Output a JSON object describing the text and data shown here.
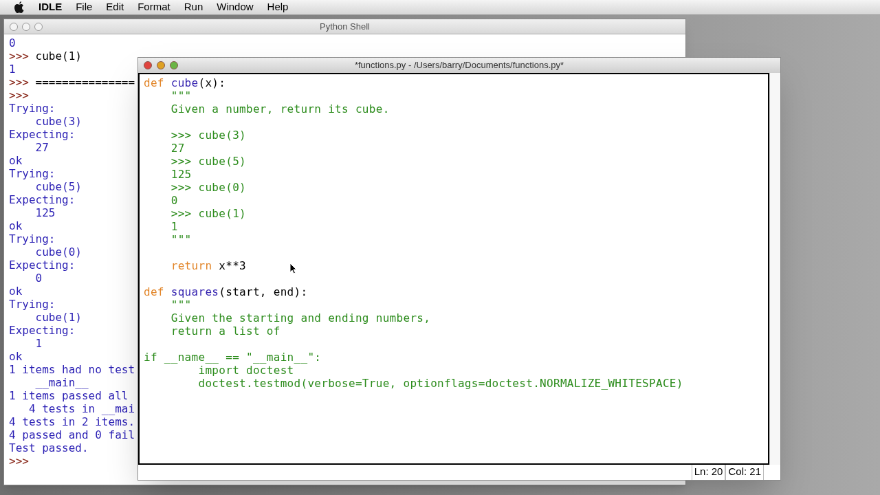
{
  "menu_bar": {
    "app": "IDLE",
    "items": [
      "File",
      "Edit",
      "Format",
      "Run",
      "Window",
      "Help"
    ]
  },
  "shell_window": {
    "title": "Python Shell",
    "active": false,
    "lines": [
      [
        {
          "text": "0",
          "kind": "output"
        }
      ],
      [
        {
          "text": ">>> ",
          "kind": "prompt"
        },
        {
          "text": "cube(1)",
          "kind": "input"
        }
      ],
      [
        {
          "text": "1",
          "kind": "output"
        }
      ],
      [
        {
          "text": ">>> ",
          "kind": "prompt"
        },
        {
          "text": "===============",
          "kind": "input"
        }
      ],
      [
        {
          "text": ">>>",
          "kind": "prompt"
        }
      ],
      [
        {
          "text": "Trying:",
          "kind": "output"
        }
      ],
      [
        {
          "text": "    cube(3)",
          "kind": "output"
        }
      ],
      [
        {
          "text": "Expecting:",
          "kind": "output"
        }
      ],
      [
        {
          "text": "    27",
          "kind": "output"
        }
      ],
      [
        {
          "text": "ok",
          "kind": "output"
        }
      ],
      [
        {
          "text": "Trying:",
          "kind": "output"
        }
      ],
      [
        {
          "text": "    cube(5)",
          "kind": "output"
        }
      ],
      [
        {
          "text": "Expecting:",
          "kind": "output"
        }
      ],
      [
        {
          "text": "    125",
          "kind": "output"
        }
      ],
      [
        {
          "text": "ok",
          "kind": "output"
        }
      ],
      [
        {
          "text": "Trying:",
          "kind": "output"
        }
      ],
      [
        {
          "text": "    cube(0)",
          "kind": "output"
        }
      ],
      [
        {
          "text": "Expecting:",
          "kind": "output"
        }
      ],
      [
        {
          "text": "    0",
          "kind": "output"
        }
      ],
      [
        {
          "text": "ok",
          "kind": "output"
        }
      ],
      [
        {
          "text": "Trying:",
          "kind": "output"
        }
      ],
      [
        {
          "text": "    cube(1)",
          "kind": "output"
        }
      ],
      [
        {
          "text": "Expecting:",
          "kind": "output"
        }
      ],
      [
        {
          "text": "    1",
          "kind": "output"
        }
      ],
      [
        {
          "text": "ok",
          "kind": "output"
        }
      ],
      [
        {
          "text": "1 items had no test",
          "kind": "output"
        }
      ],
      [
        {
          "text": "    __main__",
          "kind": "output"
        }
      ],
      [
        {
          "text": "1 items passed all",
          "kind": "output"
        }
      ],
      [
        {
          "text": "   4 tests in __mai",
          "kind": "output"
        }
      ],
      [
        {
          "text": "4 tests in 2 items.",
          "kind": "output"
        }
      ],
      [
        {
          "text": "4 passed and 0 fail",
          "kind": "output"
        }
      ],
      [
        {
          "text": "Test passed.",
          "kind": "output"
        }
      ],
      [
        {
          "text": ">>>",
          "kind": "prompt"
        }
      ]
    ]
  },
  "editor_window": {
    "title": "*functions.py - /Users/barry/Documents/functions.py*",
    "active": true,
    "lines": [
      {
        "segments": [
          {
            "text": "def ",
            "kind": "keyword"
          },
          {
            "text": "cube",
            "kind": "definition"
          },
          {
            "text": "(x):",
            "kind": "plain"
          }
        ],
        "blank_after": false
      },
      {
        "segments": [
          {
            "text": "    \"\"\"",
            "kind": "string"
          }
        ],
        "blank_after": false
      },
      {
        "segments": [
          {
            "text": "    Given a number, return its cube.",
            "kind": "string"
          }
        ],
        "blank_after": true
      },
      {
        "segments": [
          {
            "text": "    >>> cube(3)",
            "kind": "string"
          }
        ],
        "blank_after": false
      },
      {
        "segments": [
          {
            "text": "    27",
            "kind": "string"
          }
        ],
        "blank_after": false
      },
      {
        "segments": [
          {
            "text": "    >>> cube(5)",
            "kind": "string"
          }
        ],
        "blank_after": false
      },
      {
        "segments": [
          {
            "text": "    125",
            "kind": "string"
          }
        ],
        "blank_after": false
      },
      {
        "segments": [
          {
            "text": "    >>> cube(0)",
            "kind": "string"
          }
        ],
        "blank_after": false
      },
      {
        "segments": [
          {
            "text": "    0",
            "kind": "string"
          }
        ],
        "blank_after": false
      },
      {
        "segments": [
          {
            "text": "    >>> cube(1)",
            "kind": "string"
          }
        ],
        "blank_after": false
      },
      {
        "segments": [
          {
            "text": "    1",
            "kind": "string"
          }
        ],
        "blank_after": false
      },
      {
        "segments": [
          {
            "text": "    \"\"\"",
            "kind": "string"
          }
        ],
        "blank_after": true
      },
      {
        "segments": [
          {
            "text": "    return",
            "kind": "keyword"
          },
          {
            "text": " x**3",
            "kind": "plain"
          }
        ],
        "blank_after": true
      },
      {
        "segments": [
          {
            "text": "def ",
            "kind": "keyword"
          },
          {
            "text": "squares",
            "kind": "definition"
          },
          {
            "text": "(start, end):",
            "kind": "plain"
          }
        ],
        "blank_after": false
      },
      {
        "segments": [
          {
            "text": "    \"\"\"",
            "kind": "string"
          }
        ],
        "blank_after": false
      },
      {
        "segments": [
          {
            "text": "    Given the starting and ending numbers,",
            "kind": "string"
          }
        ],
        "blank_after": false
      },
      {
        "segments": [
          {
            "text": "    return a list of",
            "kind": "string"
          }
        ],
        "blank_after": true
      },
      {
        "segments": [
          {
            "text": "if __name__ == \"__main__\":",
            "kind": "string"
          }
        ],
        "blank_after": false
      },
      {
        "segments": [
          {
            "text": "        import doctest",
            "kind": "string"
          }
        ],
        "blank_after": false
      },
      {
        "segments": [
          {
            "text": "        doctest.testmod(verbose=True, optionflags=doctest.NORMALIZE_WHITESPACE)",
            "kind": "string"
          }
        ],
        "blank_after": false
      }
    ],
    "status_bar": [
      "Ln: 20",
      "Col: 21"
    ]
  }
}
